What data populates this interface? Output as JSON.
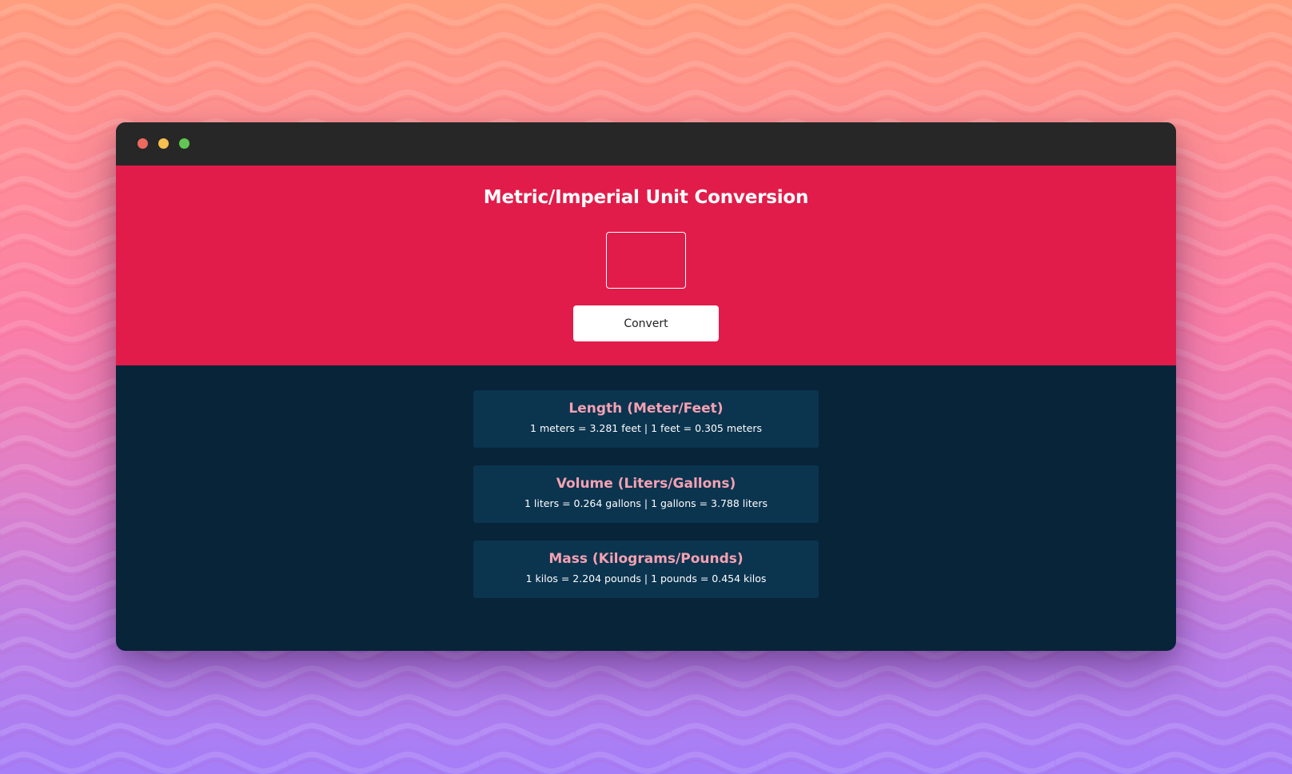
{
  "app": {
    "title": "Metric/Imperial Unit Conversion"
  },
  "input": {
    "value": "",
    "placeholder": ""
  },
  "convert_button": {
    "label": "Convert"
  },
  "conversions": [
    {
      "title": "Length (Meter/Feet)",
      "text": "1 meters = 3.281 feet | 1 feet = 0.305 meters"
    },
    {
      "title": "Volume (Liters/Gallons)",
      "text": "1 liters = 0.264 gallons | 1 gallons = 3.788 liters"
    },
    {
      "title": "Mass (Kilograms/Pounds)",
      "text": "1 kilos = 2.204 pounds | 1 pounds = 0.454 kilos"
    }
  ],
  "colors": {
    "hero_background": "#e21c4a",
    "results_background": "#082438",
    "card_background": "#0b344f",
    "card_title": "#f4a1b2",
    "titlebar": "#272727"
  },
  "window_controls": {
    "close_icon": "red-dot",
    "minimize_icon": "yellow-dot",
    "zoom_icon": "green-dot"
  }
}
